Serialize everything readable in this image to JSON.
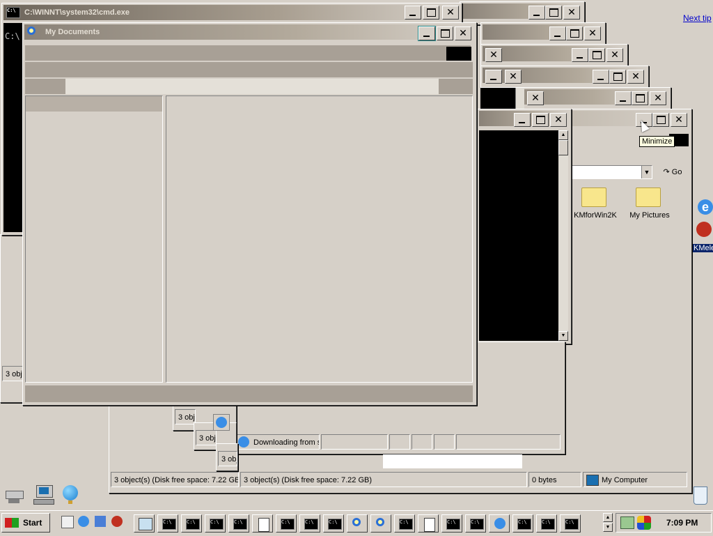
{
  "cmd_window": {
    "title": "C:\\WINNT\\system32\\cmd.exe",
    "prompt": "C:\\"
  },
  "my_documents": {
    "title": "My Documents"
  },
  "back_window": {
    "address_go": "Go",
    "items": [
      {
        "label": "KMforWin2K"
      },
      {
        "label": "My Pictures"
      }
    ],
    "tooltip": "Minimize"
  },
  "desktop": {
    "next_tip": "Next tip",
    "icon_label": "KMele"
  },
  "status": {
    "objects_short": "3 obje",
    "objects_short2": "3 obj",
    "objects_short3": "3 obj",
    "objects_short4": "3 obj",
    "downloading": "Downloading from s",
    "left_objects": "3 object(s) (Disk free space: 7.22 GB)",
    "right_objects": "3 object(s) (Disk free space: 7.22 GB)",
    "size": "0 bytes",
    "zone": "My Computer"
  },
  "taskbar": {
    "start": "Start",
    "clock": "7:09 PM",
    "buttons": [
      "notepad",
      "cmd",
      "cmd",
      "cmd",
      "cmd",
      "tool",
      "cmd",
      "cmd",
      "cmd",
      "search",
      "search",
      "cmd",
      "tool",
      "cmd",
      "cmd",
      "ie",
      "cmd",
      "cmd",
      "cmd"
    ]
  },
  "colors": {
    "titlebar": "#8a8278",
    "face": "#d6d0c8",
    "console": "#000000"
  }
}
